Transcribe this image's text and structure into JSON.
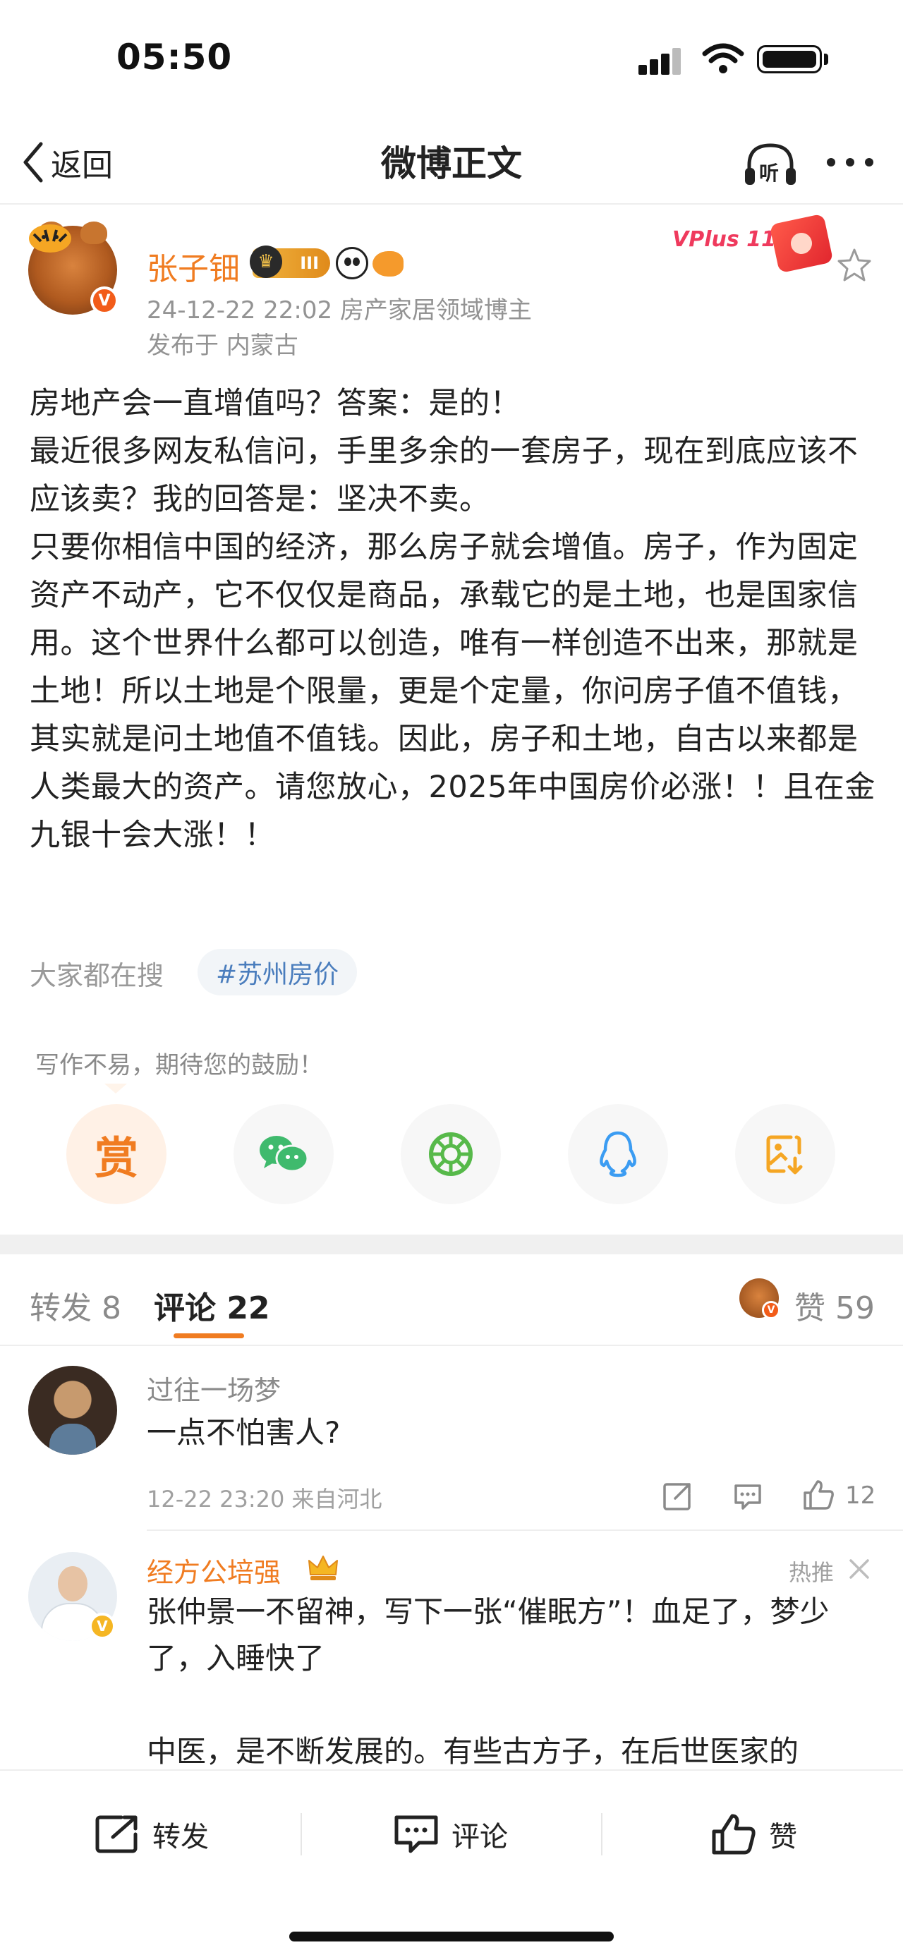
{
  "status_bar": {
    "time": "05:50"
  },
  "nav": {
    "back_label": "返回",
    "title": "微博正文",
    "listen_label": "听"
  },
  "post": {
    "author": "张子钿",
    "level_badge": "III",
    "timestamp_domain": "24-12-22 22:02  房产家居领域博主",
    "location": "发布于 内蒙古",
    "promo_label": "VPlus 11.11",
    "paragraphs": [
      "房地产会一直增值吗？答案：是的！",
      "最近很多网友私信问，手里多余的一套房子，现在到底应该不应该卖？我的回答是：坚决不卖。",
      "只要你相信中国的经济，那么房子就会增值。房子，作为固定资产不动产，它不仅仅是商品，承载它的是土地，也是国家信用。这个世界什么都可以创造，唯有一样创造不出来，那就是土地！所以土地是个限量，更是个定量，你问房子值不值钱，其实就是问土地值不值钱。因此，房子和土地，自古以来都是人类最大的资产。请您放心，2025年中国房价必涨！！且在金九银十会大涨！！"
    ],
    "search_label": "大家都在搜",
    "topic": "#苏州房价"
  },
  "reward": {
    "tip": "写作不易，期待您的鼓励！",
    "reward_glyph": "赏",
    "share_targets": [
      "reward",
      "wechat",
      "moments",
      "qq",
      "save-image"
    ]
  },
  "tabs": {
    "repost": "转发 8",
    "comment": "评论 22",
    "like": "赞 59"
  },
  "comments": [
    {
      "name": "过往一场梦",
      "text": "一点不怕害人?",
      "meta": "12-22 23:20 来自河北",
      "likes": "12"
    },
    {
      "name": "经方公培强",
      "hot_label": "热推",
      "text_lines": [
        "张仲景一不留神，写下一张“催眠方”！血足了，梦少了，入睡快了",
        "",
        "中医，是不断发展的。有些古方子，在后世医家的"
      ]
    }
  ],
  "bottom_bar": {
    "repost": "转发",
    "comment": "评论",
    "like": "赞"
  },
  "colors": {
    "accent": "#f07c21",
    "link": "#4a7dbd",
    "muted": "#8a8a8a"
  }
}
